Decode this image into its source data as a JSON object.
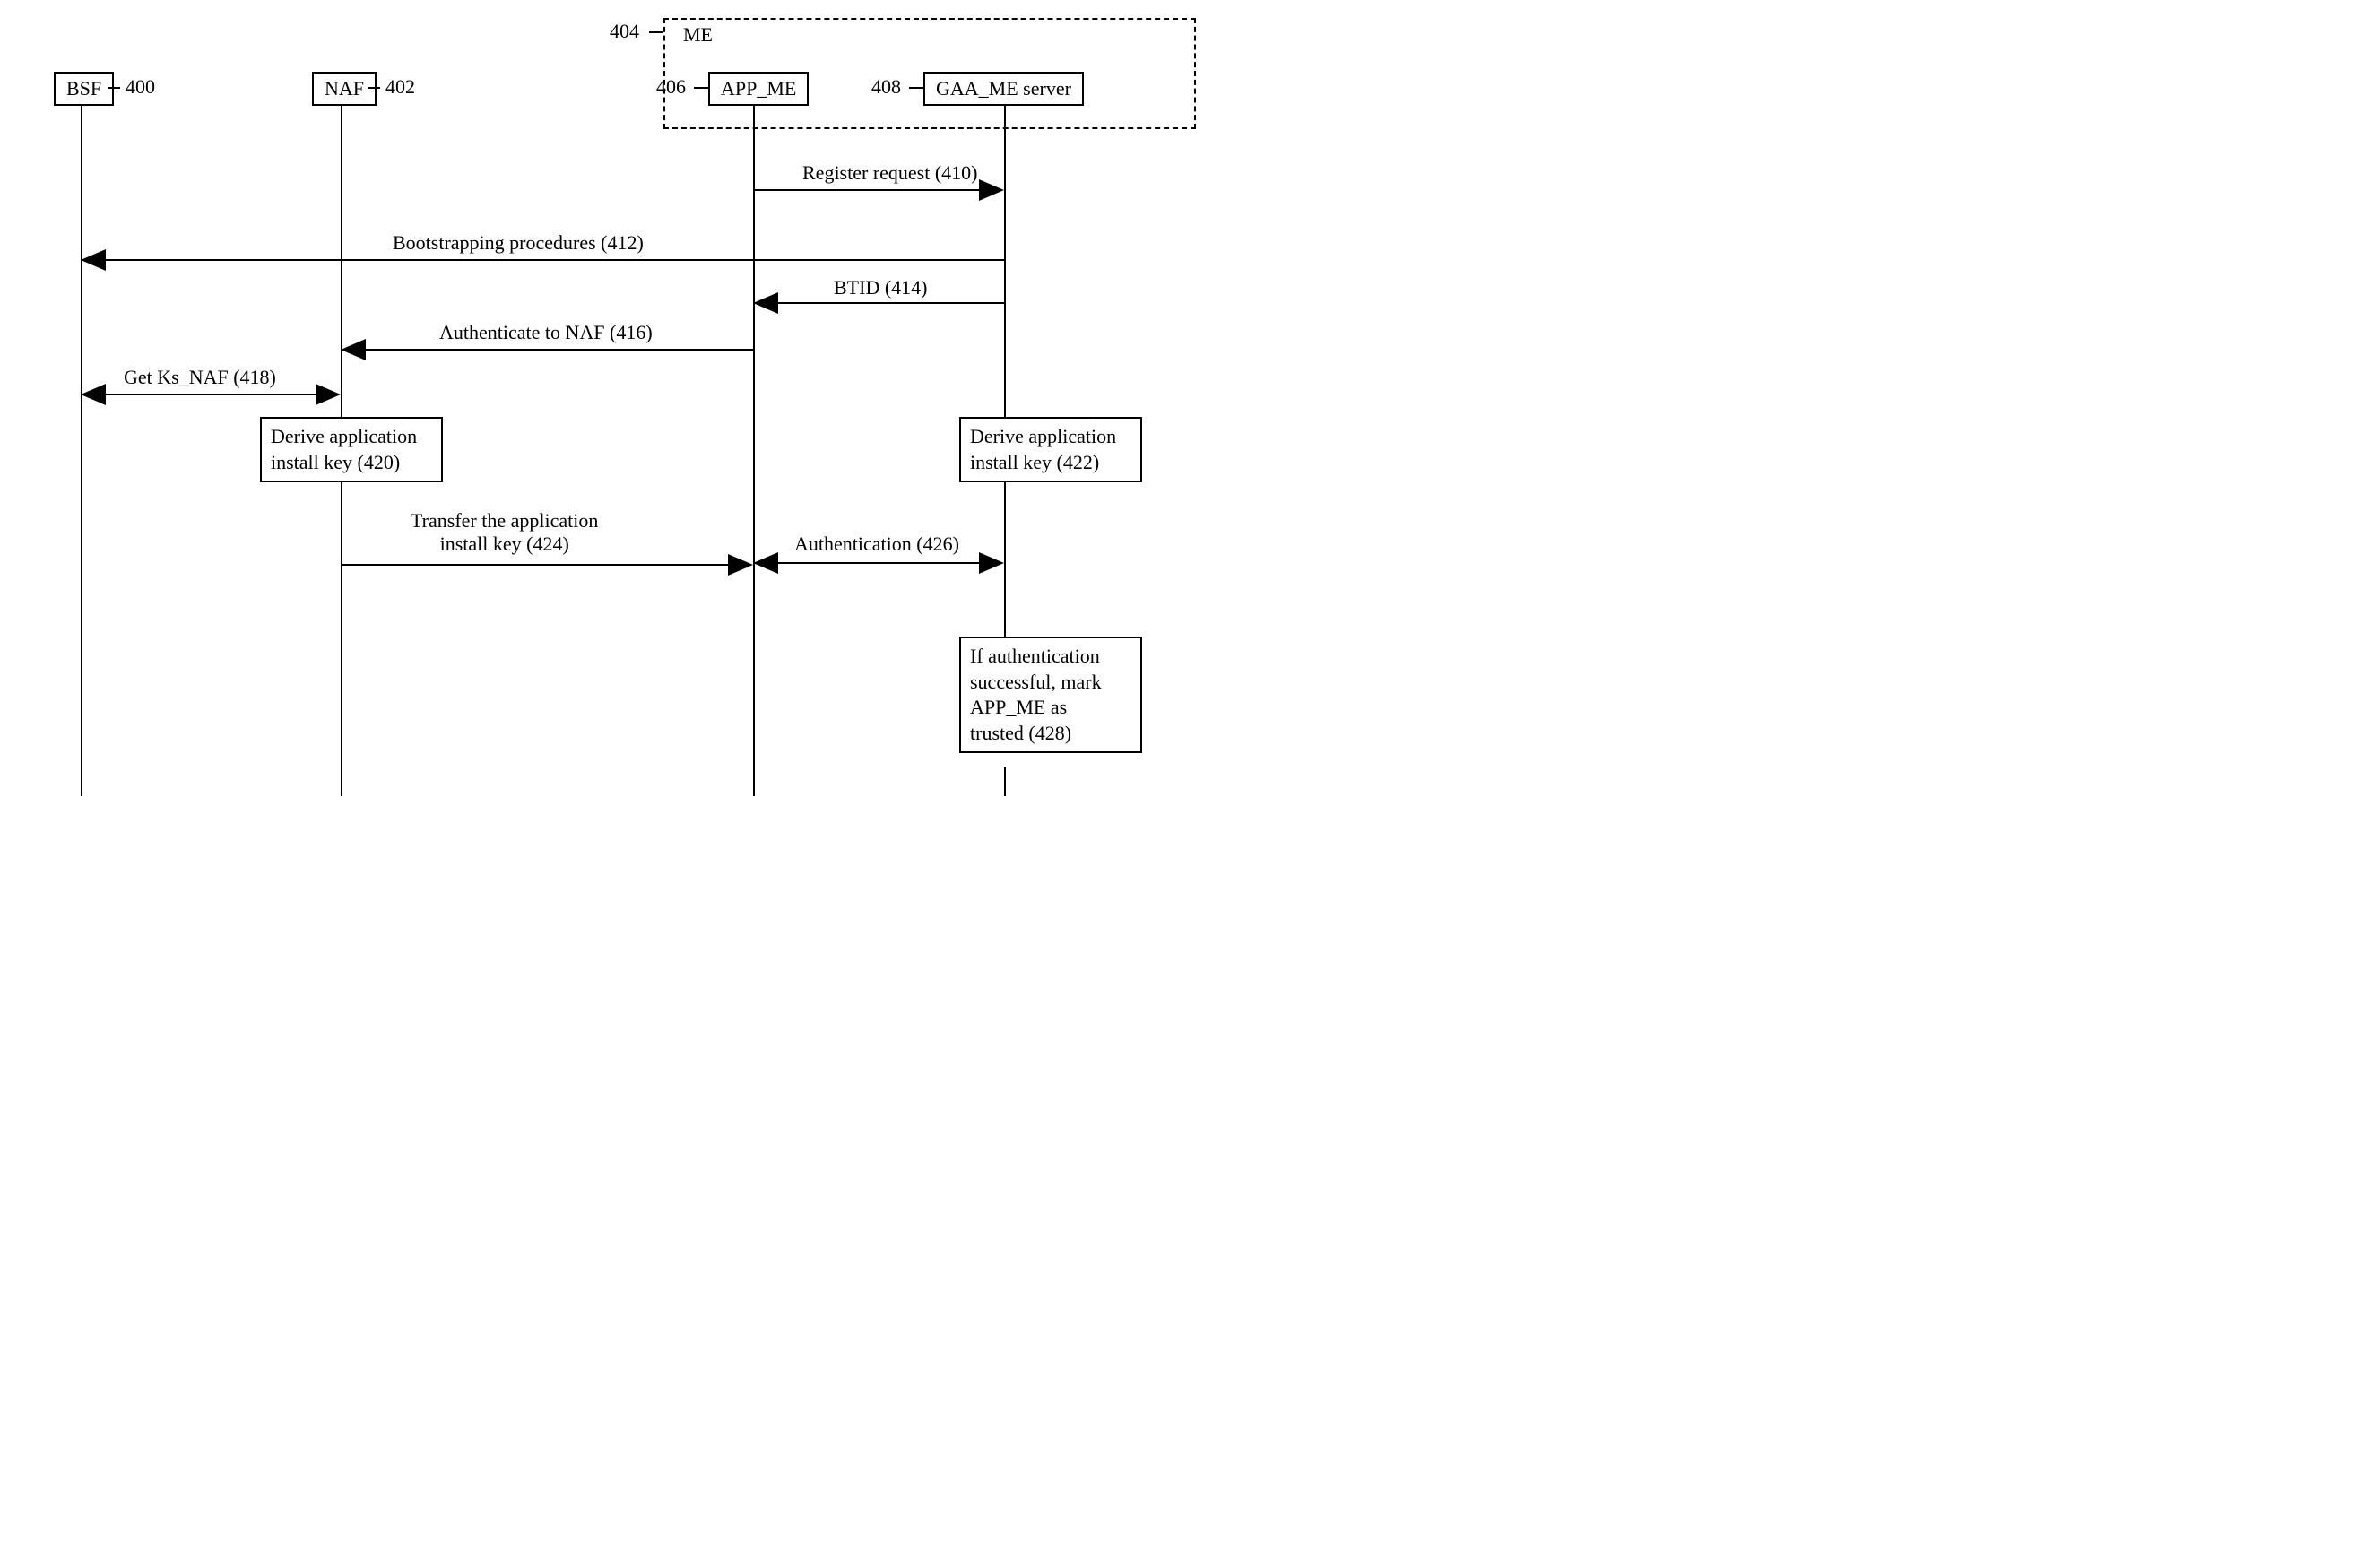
{
  "actors": {
    "bsf": {
      "label": "BSF",
      "ref": "400"
    },
    "naf": {
      "label": "NAF",
      "ref": "402"
    },
    "me": {
      "label": "ME",
      "ref": "404"
    },
    "app_me": {
      "label": "APP_ME",
      "ref": "406"
    },
    "gaa_me": {
      "label": "GAA_ME server",
      "ref": "408"
    }
  },
  "messages": {
    "m410": "Register request (410)",
    "m412": "Bootstrapping procedures (412)",
    "m414": "BTID (414)",
    "m416": "Authenticate to NAF (416)",
    "m418": "Get Ks_NAF (418)",
    "m424_l1": "Transfer the application",
    "m424_l2": "install key (424)",
    "m426": "Authentication (426)"
  },
  "steps": {
    "s420_l1": "Derive application",
    "s420_l2": "install key (420)",
    "s422_l1": "Derive application",
    "s422_l2": "install key (422)",
    "s428_l1": "If authentication",
    "s428_l2": "successful, mark",
    "s428_l3": "APP_ME as",
    "s428_l4": "trusted (428)"
  }
}
